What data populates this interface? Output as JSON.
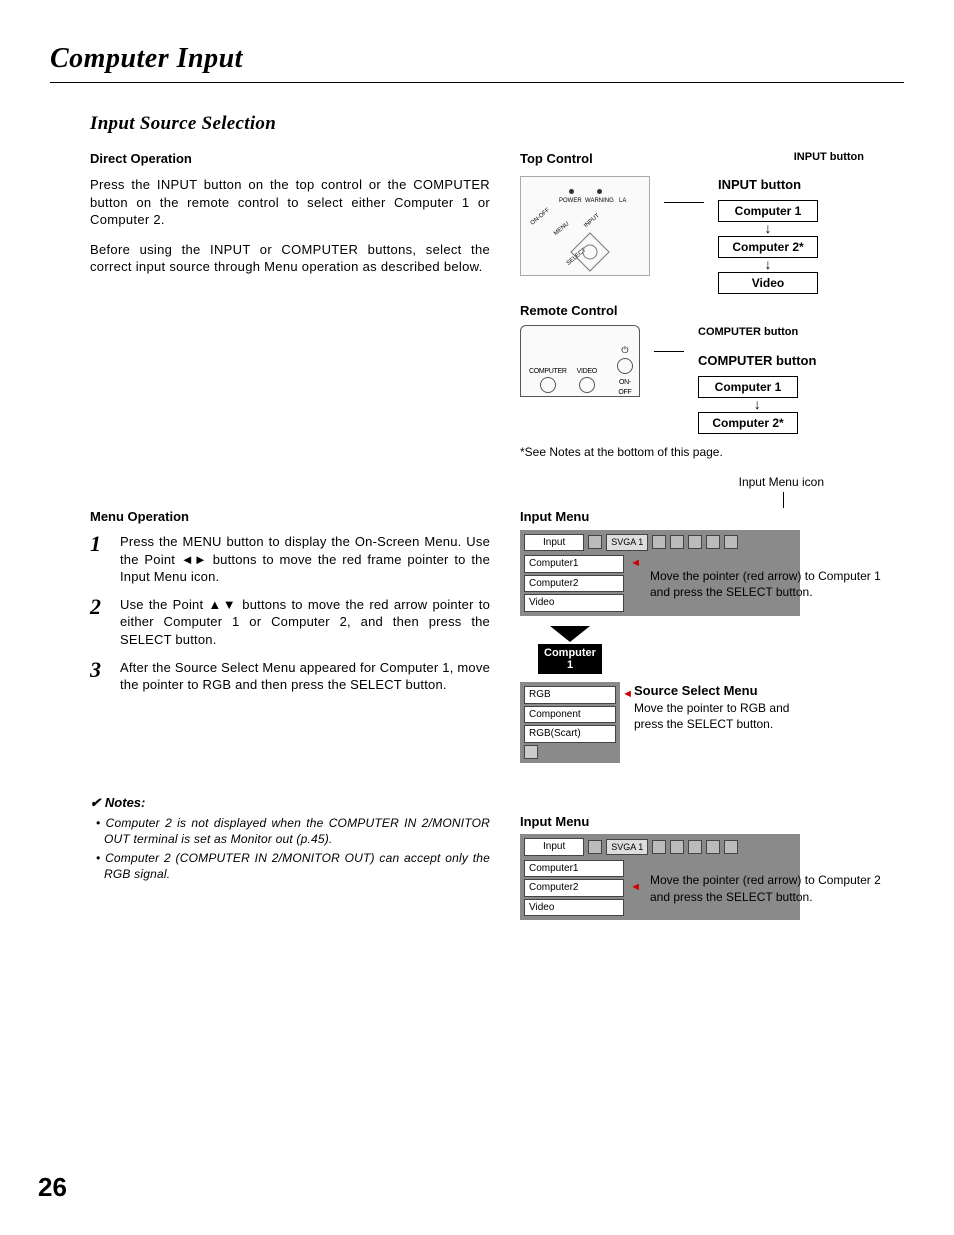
{
  "title": "Computer Input",
  "section_title": "Input Source Selection",
  "direct_operation": {
    "heading": "Direct Operation",
    "para1": "Press the INPUT button on the top control or the COMPUTER button on the remote control to select either Computer 1 or Computer 2.",
    "para2": "Before using the INPUT or COMPUTER buttons, select the correct input source through Menu operation as described below."
  },
  "menu_operation": {
    "heading": "Menu Operation",
    "steps": [
      "Press the MENU button to display the On-Screen Menu. Use the Point ◄► buttons to move the red frame pointer to the Input Menu icon.",
      "Use the Point ▲▼ buttons to move the red arrow pointer to either Computer 1 or Computer 2, and then press the SELECT button.",
      "After the Source Select Menu appeared for Computer 1, move the pointer to RGB and then press the SELECT button."
    ]
  },
  "notes": {
    "heading": "Notes:",
    "items": [
      "Computer 2 is not displayed when the COMPUTER IN 2/MONITOR OUT terminal is set as Monitor out (p.45).",
      "Computer 2 (COMPUTER IN 2/MONITOR OUT) can accept only the RGB signal."
    ]
  },
  "right": {
    "top_control": "Top Control",
    "input_button_caption": "INPUT button",
    "input_button_head": "INPUT button",
    "input_seq": [
      "Computer 1",
      "Computer 2*",
      "Video"
    ],
    "remote_control": "Remote Control",
    "remote_labels": {
      "computer": "COMPUTER",
      "video": "VIDEO",
      "onoff": "ON-OFF"
    },
    "computer_button_caption": "COMPUTER button",
    "computer_button_head": "COMPUTER button",
    "computer_seq": [
      "Computer 1",
      "Computer 2*"
    ],
    "see_notes": "*See Notes at the bottom of this page.",
    "input_menu_icon": "Input Menu icon",
    "input_menu": "Input Menu",
    "menu_bar_label": "Input",
    "menu_bar_tag": "SVGA 1",
    "menu_items": [
      "Computer1",
      "Computer2",
      "Video"
    ],
    "caption1": "Move the pointer (red arrow) to Computer 1 and press the SELECT button.",
    "black_box": "Computer 1",
    "source_select_menu": "Source Select Menu",
    "source_items": [
      "RGB",
      "Component",
      "RGB(Scart)"
    ],
    "caption_source": "Move the pointer to RGB and press the SELECT button.",
    "input_menu2": "Input Menu",
    "caption2": "Move the pointer (red arrow) to Computer 2 and press the SELECT button.",
    "tc_labels": {
      "power": "POWER",
      "warning": "WARNING",
      "lamp": "LA",
      "onoff": "ON-OFF",
      "menu": "MENU",
      "input": "INPUT",
      "select": "SELECT"
    }
  },
  "page_number": "26"
}
